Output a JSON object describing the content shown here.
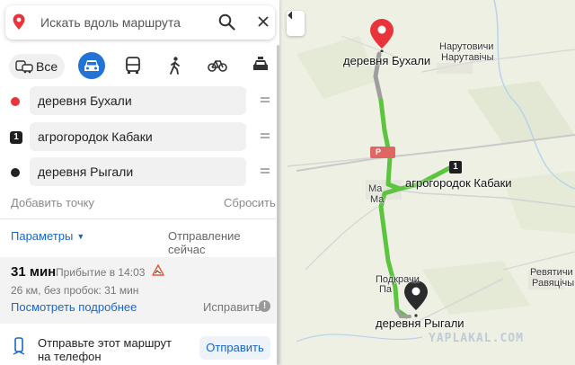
{
  "search": {
    "placeholder": "Искать вдоль маршрута"
  },
  "modes": {
    "all_label": "Все",
    "active": "car"
  },
  "waypoints": [
    {
      "label": "деревня Бухали",
      "marker": "red-dot",
      "color": "#e8343a"
    },
    {
      "label": "агрогородок Кабаки",
      "marker": "1"
    },
    {
      "label": "деревня Рыгали",
      "marker": "black-dot",
      "color": "#222222"
    }
  ],
  "actions": {
    "add_point": "Добавить точку",
    "reset": "Сбросить"
  },
  "options": {
    "params": "Параметры",
    "departure": "Отправление сейчас"
  },
  "route": {
    "time": "31 мин",
    "arrival": "Прибытие в 14:03",
    "distance": "26 км, без пробок: 31 мин",
    "details_link": "Посмотреть подробнее",
    "fix_link": "Исправить"
  },
  "send": {
    "text": "Отправьте этот маршрут на телефон",
    "button": "Отправить"
  },
  "map": {
    "labels": {
      "start": "деревня Бухали",
      "waypoint": "агрогородок Кабаки",
      "end": "деревня Рыгали",
      "narutovichi_1": "Нарутовичи",
      "narutovichi_2": "Нарутавічы",
      "revyatichi_1": "Ревятичи",
      "revyatichi_2": "Равяцічы",
      "mal_1": "Ма",
      "mal_2": "Ма",
      "podkr_1": "Подкрачи",
      "podkr_2": "Па",
      "road_badge": "Р",
      "waypoint_num": "1"
    },
    "route_color": "#5cc43f",
    "watermark": "YAPLAKAL.COM"
  },
  "colors": {
    "accent": "#2174d6",
    "link": "#1a66c9",
    "start_pin": "#e8343a"
  }
}
